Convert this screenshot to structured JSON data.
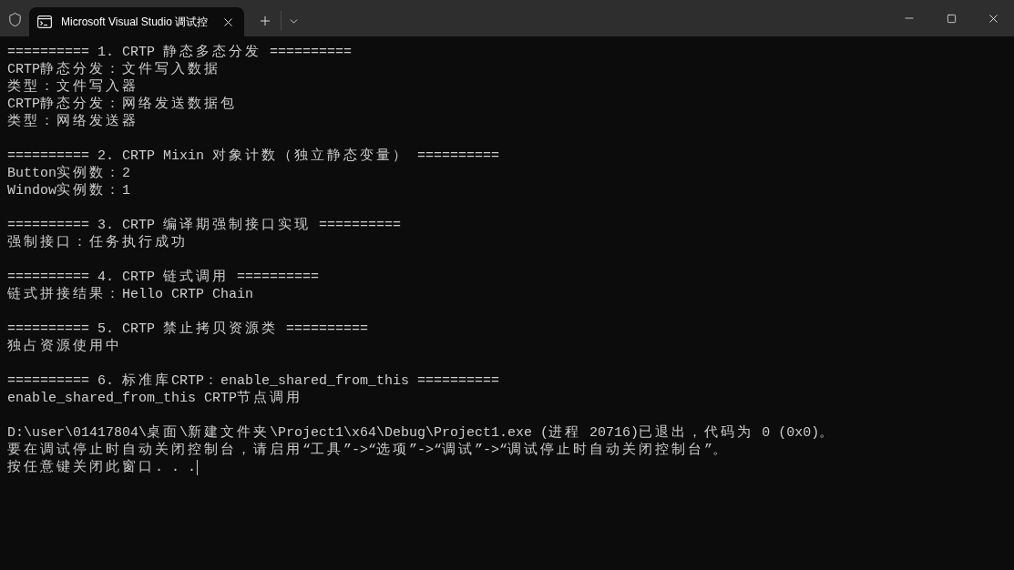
{
  "window": {
    "tab": {
      "title": "Microsoft Visual Studio 调试控"
    }
  },
  "console": {
    "sections": [
      {
        "heading": "========== 1. CRTP 静态多态分发 ==========",
        "lines": [
          "CRTP静态分发：文件写入数据",
          "类型：文件写入器",
          "CRTP静态分发：网络发送数据包",
          "类型：网络发送器"
        ]
      },
      {
        "heading": "========== 2. CRTP Mixin 对象计数（独立静态变量） ==========",
        "lines": [
          "Button实例数：2",
          "Window实例数：1"
        ]
      },
      {
        "heading": "========== 3. CRTP 编译期强制接口实现 ==========",
        "lines": [
          "强制接口：任务执行成功"
        ]
      },
      {
        "heading": "========== 4. CRTP 链式调用 ==========",
        "lines": [
          "链式拼接结果：Hello CRTP Chain"
        ]
      },
      {
        "heading": "========== 5. CRTP 禁止拷贝资源类 ==========",
        "lines": [
          "独占资源使用中"
        ]
      },
      {
        "heading": "========== 6. 标准库CRTP：enable_shared_from_this ==========",
        "lines": [
          "enable_shared_from_this CRTP节点调用"
        ]
      }
    ],
    "exit_message": [
      "D:\\user\\01417804\\桌面\\新建文件夹\\Project1\\x64\\Debug\\Project1.exe (进程 20716)已退出，代码为 0 (0x0)。",
      "要在调试停止时自动关闭控制台，请启用“工具”->“选项”->“调试”->“调试停止时自动关闭控制台”。",
      "按任意键关闭此窗口. . ."
    ]
  }
}
